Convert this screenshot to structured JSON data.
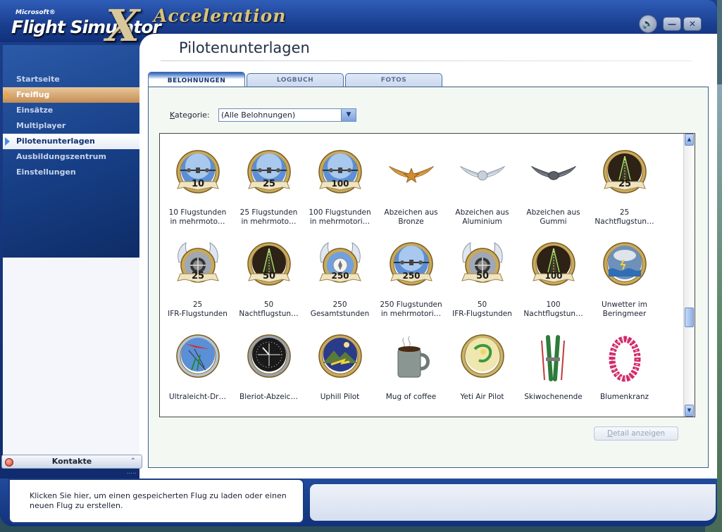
{
  "app": {
    "logo_microsoft": "Microsoft®",
    "logo_name": "Flight Simulator",
    "logo_x": "X",
    "logo_edition": "Acceleration"
  },
  "sidebar": {
    "items": [
      {
        "label": "Startseite",
        "state": "normal"
      },
      {
        "label": "Freiflug",
        "state": "hover"
      },
      {
        "label": "Einsätze",
        "state": "normal"
      },
      {
        "label": "Multiplayer",
        "state": "normal"
      },
      {
        "label": "Pilotenunterlagen",
        "state": "active"
      },
      {
        "label": "Ausbildungszentrum",
        "state": "normal"
      },
      {
        "label": "Einstellungen",
        "state": "normal"
      }
    ]
  },
  "page": {
    "title": "Pilotenunterlagen",
    "tabs": [
      {
        "label": "BELOHNUNGEN",
        "active": true
      },
      {
        "label": "LOGBUCH",
        "active": false
      },
      {
        "label": "FOTOS",
        "active": false
      }
    ],
    "category": {
      "label_k": "K",
      "label_rest": "ategorie:",
      "value": "(Alle Belohnungen)"
    },
    "detail_button": {
      "u": "D",
      "rest": "etail anzeigen"
    }
  },
  "awards": [
    {
      "label": "10 Flugstunden\nin mehrmoto…",
      "icon": "multi-engine-badge",
      "number": "10"
    },
    {
      "label": "25 Flugstunden\nin mehrmoto…",
      "icon": "multi-engine-badge",
      "number": "25"
    },
    {
      "label": "100 Flugstunden\nin mehrmotori…",
      "icon": "multi-engine-badge",
      "number": "100"
    },
    {
      "label": "Abzeichen aus\nBronze",
      "icon": "bronze-wings",
      "number": ""
    },
    {
      "label": "Abzeichen aus\nAluminium",
      "icon": "aluminium-wings",
      "number": ""
    },
    {
      "label": "Abzeichen aus\nGummi",
      "icon": "rubber-wings",
      "number": ""
    },
    {
      "label": "25\nNachtflugstun…",
      "icon": "night-flight-badge",
      "number": "25"
    },
    {
      "label": "25\nIFR-Flugstunden",
      "icon": "ifr-badge",
      "number": "25"
    },
    {
      "label": "50\nNachtflugstun…",
      "icon": "night-flight-badge",
      "number": "50"
    },
    {
      "label": "250\nGesamtstunden",
      "icon": "total-hours-badge",
      "number": "250"
    },
    {
      "label": "250 Flugstunden\nin mehrmotori…",
      "icon": "multi-engine-badge",
      "number": "250"
    },
    {
      "label": "50\nIFR-Flugstunden",
      "icon": "ifr-badge",
      "number": "50"
    },
    {
      "label": "100\nNachtflugstun…",
      "icon": "night-flight-badge",
      "number": "100"
    },
    {
      "label": "Unwetter im\nBeringmeer",
      "icon": "storm-badge",
      "number": ""
    },
    {
      "label": "Ultraleicht-Dr…",
      "icon": "hang-glider-badge",
      "number": ""
    },
    {
      "label": "Bleriot-Abzeic…",
      "icon": "gauge-badge",
      "number": ""
    },
    {
      "label": "Uphill Pilot",
      "icon": "mountain-badge",
      "number": ""
    },
    {
      "label": "Mug of coffee",
      "icon": "coffee-mug",
      "number": ""
    },
    {
      "label": "Yeti Air Pilot",
      "icon": "yeti-badge",
      "number": ""
    },
    {
      "label": "Skiwochenende",
      "icon": "skis",
      "number": ""
    },
    {
      "label": "Blumenkranz",
      "icon": "flower-lei",
      "number": ""
    }
  ],
  "footer": {
    "contacts_label": "Kontakte",
    "hint_text": "Klicken Sie hier, um einen gespeicherten Flug zu laden oder einen neuen Flug zu erstellen."
  },
  "colors": {
    "frame": "#1a3e8f",
    "accent_gold": "#d9c27a",
    "panel_bg": "#f3f9f2"
  }
}
